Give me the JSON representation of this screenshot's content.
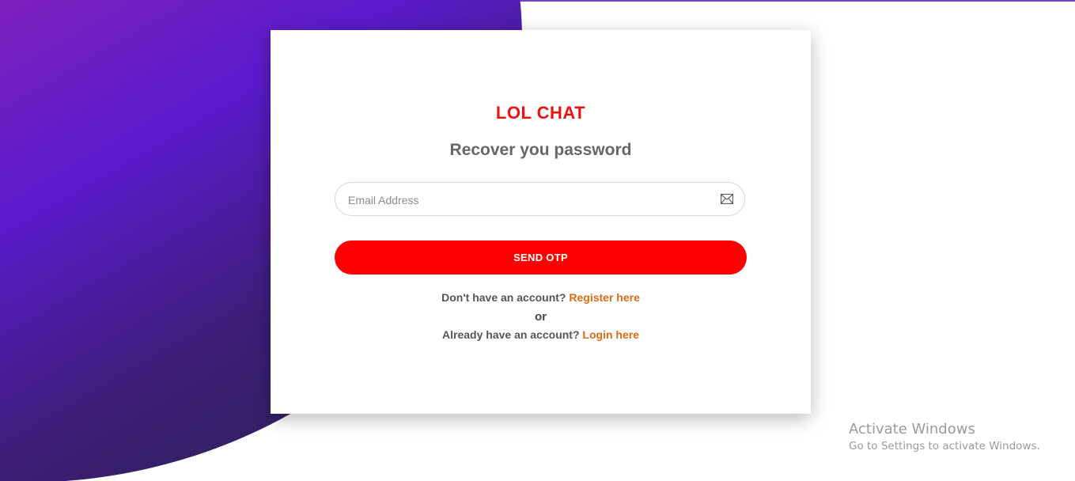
{
  "brand": "LOL CHAT",
  "heading": "Recover you password",
  "email": {
    "placeholder": "Email Address",
    "value": "",
    "icon": "envelope-icon"
  },
  "send_button_label": "SEND OTP",
  "register": {
    "prompt": "Don't have an account?",
    "link": "Register here"
  },
  "or_text": "or",
  "login": {
    "prompt": "Already have an account?",
    "link": "Login here"
  },
  "watermark": {
    "title": "Activate Windows",
    "subtitle": "Go to Settings to activate Windows."
  },
  "colors": {
    "brand": "#ee1010",
    "button": "#ff0000",
    "link": "#e06a12",
    "gradient_start": "#ff4159",
    "gradient_mid": "#5a1bcc",
    "gradient_end": "#2b2453"
  }
}
